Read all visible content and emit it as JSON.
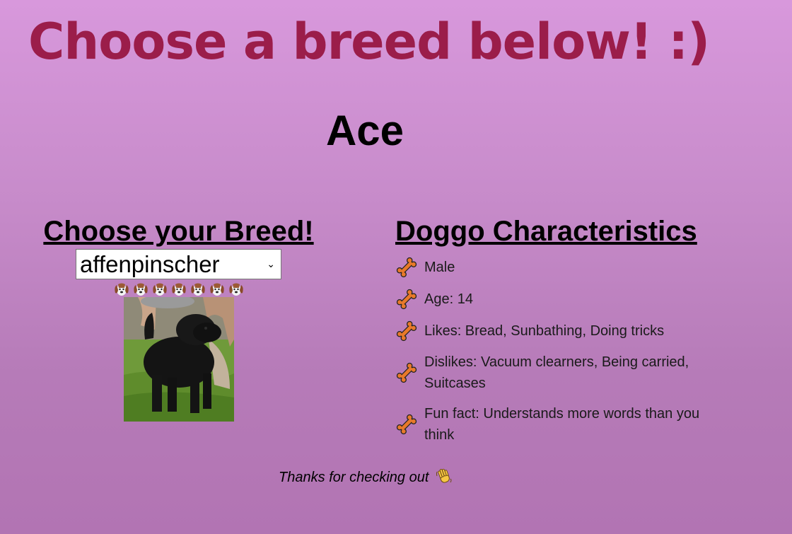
{
  "page": {
    "title": "Choose a breed below! :)",
    "dog_name": "Ace"
  },
  "breed_panel": {
    "heading": "Choose your Breed!",
    "selected_breed": "affenpinscher",
    "dog_emoji_count": 7
  },
  "characteristics": {
    "heading": "Doggo Characteristics",
    "items": [
      {
        "text": "Male",
        "icon": "bone-icon"
      },
      {
        "text": "Age: 14",
        "icon": "bone-icon"
      },
      {
        "text": "Likes: Bread, Sunbathing, Doing tricks",
        "icon": "bone-icon"
      },
      {
        "text": "Dislikes: Vacuum clearners, Being carried, Suitcases",
        "icon": "bone-icon"
      },
      {
        "text": "Fun fact: Understands more words than you think",
        "icon": "bone-icon"
      }
    ]
  },
  "footer": {
    "text": "Thanks for checking out",
    "icon": "waving-hand-icon"
  },
  "colors": {
    "title": "#9b1d4a",
    "background_top": "#d898dc",
    "background_bottom": "#b274b3",
    "bone": "#e8792a"
  }
}
